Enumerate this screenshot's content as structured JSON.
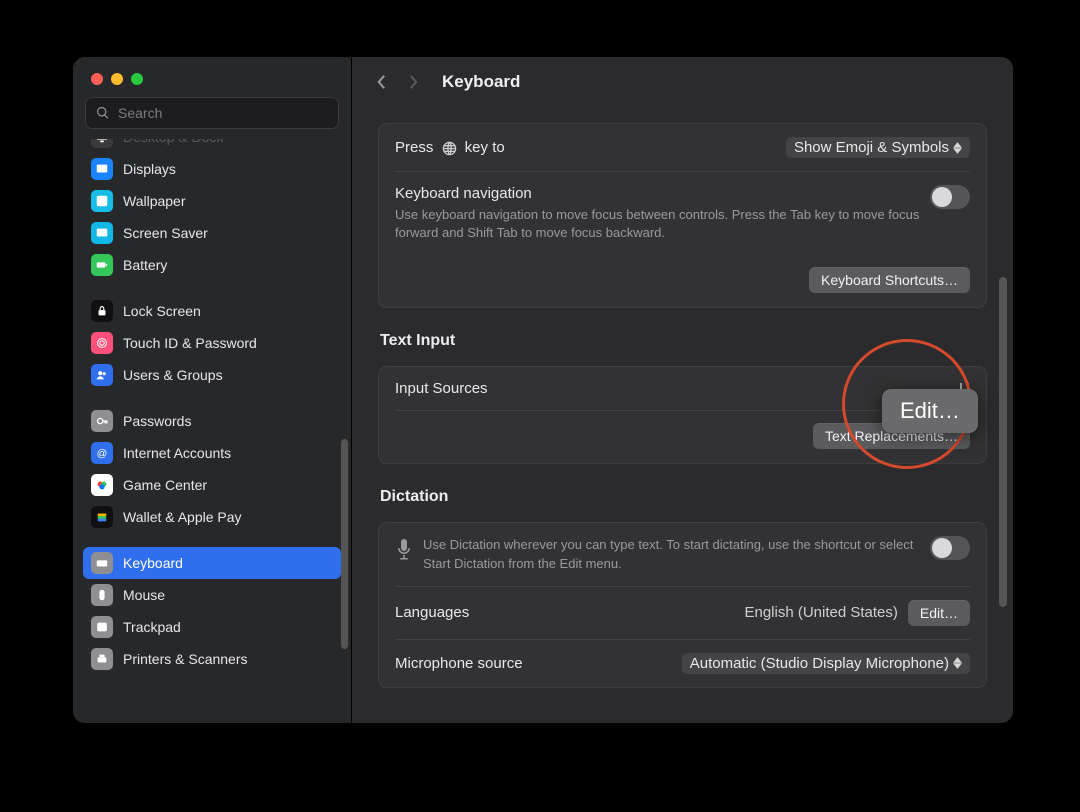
{
  "window": {
    "search_placeholder": "Search"
  },
  "header": {
    "title": "Keyboard"
  },
  "sidebar": {
    "items": [
      {
        "label": "Desktop & Dock",
        "icon": "desktop-icon",
        "icon_bg": "#3a3a3c",
        "cutoff": true
      },
      {
        "label": "Displays",
        "icon": "displays-icon",
        "icon_bg": "#1a84ff"
      },
      {
        "label": "Wallpaper",
        "icon": "wallpaper-icon",
        "icon_bg": "#18bde7"
      },
      {
        "label": "Screen Saver",
        "icon": "screensaver-icon",
        "icon_bg": "#12b7e5"
      },
      {
        "label": "Battery",
        "icon": "battery-icon",
        "icon_bg": "#34c759"
      },
      {
        "gap": true
      },
      {
        "label": "Lock Screen",
        "icon": "lockscreen-icon",
        "icon_bg": "#101012"
      },
      {
        "label": "Touch ID & Password",
        "icon": "touchid-icon",
        "icon_bg": "#ff4f7b"
      },
      {
        "label": "Users & Groups",
        "icon": "users-icon",
        "icon_bg": "#2f6fed"
      },
      {
        "gap": true
      },
      {
        "label": "Passwords",
        "icon": "key-icon",
        "icon_bg": "#8e8e93"
      },
      {
        "label": "Internet Accounts",
        "icon": "at-icon",
        "icon_bg": "#2f6fed"
      },
      {
        "label": "Game Center",
        "icon": "gamecenter-icon",
        "icon_bg": "#ffffff"
      },
      {
        "label": "Wallet & Apple Pay",
        "icon": "wallet-icon",
        "icon_bg": "#101012"
      },
      {
        "gap": true
      },
      {
        "label": "Keyboard",
        "icon": "keyboard-icon",
        "icon_bg": "#8e8e93",
        "selected": true
      },
      {
        "label": "Mouse",
        "icon": "mouse-icon",
        "icon_bg": "#8e8e93"
      },
      {
        "label": "Trackpad",
        "icon": "trackpad-icon",
        "icon_bg": "#8e8e93"
      },
      {
        "label": "Printers & Scanners",
        "icon": "printer-icon",
        "icon_bg": "#8e8e93"
      }
    ]
  },
  "main": {
    "press_key_label_pre": "Press ",
    "press_key_label_post": " key to",
    "press_key_value": "Show Emoji & Symbols",
    "nav_label": "Keyboard navigation",
    "nav_desc": "Use keyboard navigation to move focus between controls. Press the Tab key to move focus forward and Shift Tab to move focus backward.",
    "shortcuts_btn": "Keyboard Shortcuts…",
    "text_input_title": "Text Input",
    "input_sources_label": "Input Sources",
    "input_sources_value": "U",
    "text_replace_btn": "Text Replacements…",
    "dictation_title": "Dictation",
    "dictation_desc": "Use Dictation wherever you can type text. To start dictating, use the shortcut or select Start Dictation from the Edit menu.",
    "languages_label": "Languages",
    "languages_value": "English (United States)",
    "languages_edit": "Edit…",
    "mic_label": "Microphone source",
    "mic_value": "Automatic (Studio Display Microphone)"
  },
  "highlight": {
    "edit_label": "Edit…"
  }
}
